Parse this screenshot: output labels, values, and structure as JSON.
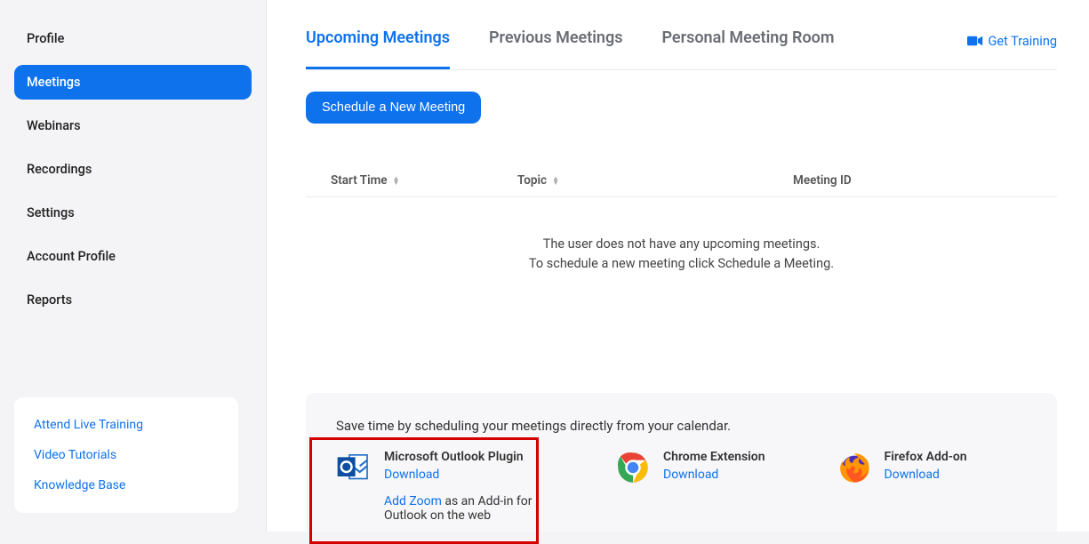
{
  "sidebar": {
    "items": [
      {
        "label": "Profile",
        "active": false
      },
      {
        "label": "Meetings",
        "active": true
      },
      {
        "label": "Webinars",
        "active": false
      },
      {
        "label": "Recordings",
        "active": false
      },
      {
        "label": "Settings",
        "active": false
      },
      {
        "label": "Account Profile",
        "active": false
      },
      {
        "label": "Reports",
        "active": false
      }
    ],
    "help": {
      "live_training": "Attend Live Training",
      "video_tutorials": "Video Tutorials",
      "knowledge_base": "Knowledge Base"
    }
  },
  "tabs": {
    "upcoming": "Upcoming Meetings",
    "previous": "Previous Meetings",
    "pmr": "Personal Meeting Room"
  },
  "header": {
    "get_training": "Get Training"
  },
  "actions": {
    "schedule": "Schedule a New Meeting"
  },
  "table": {
    "start_time": "Start Time",
    "topic": "Topic",
    "meeting_id": "Meeting ID"
  },
  "empty": {
    "line1": "The user does not have any upcoming meetings.",
    "line2": "To schedule a new meeting click Schedule a Meeting."
  },
  "promo": {
    "heading": "Save time by scheduling your meetings directly from your calendar.",
    "outlook": {
      "title": "Microsoft Outlook Plugin",
      "download": "Download",
      "add_zoom": "Add Zoom",
      "addin_tail": " as an Add-in for Outlook on the web"
    },
    "chrome": {
      "title": "Chrome Extension",
      "download": "Download"
    },
    "firefox": {
      "title": "Firefox Add-on",
      "download": "Download"
    }
  }
}
